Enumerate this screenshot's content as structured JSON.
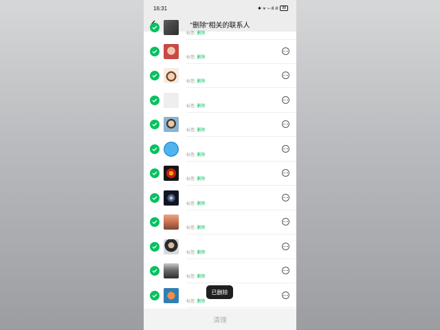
{
  "status_bar": {
    "time": "16:31",
    "icons": "✱ ᯤ ⌁ ıll ıll",
    "battery": "88"
  },
  "nav": {
    "title": "\"删除\"相关的联系人",
    "back_icon": "chevron-left-icon"
  },
  "rows": [
    {
      "tag_label": "标签:",
      "tag_value": "删除"
    },
    {
      "tag_label": "标签:",
      "tag_value": "删除"
    },
    {
      "tag_label": "标签:",
      "tag_value": "删除"
    },
    {
      "tag_label": "标签:",
      "tag_value": "删除"
    },
    {
      "tag_label": "标签:",
      "tag_value": "删除"
    },
    {
      "tag_label": "标签:",
      "tag_value": "删除"
    },
    {
      "tag_label": "标签:",
      "tag_value": "删除"
    },
    {
      "tag_label": "标签:",
      "tag_value": "删除"
    },
    {
      "tag_label": "标签:",
      "tag_value": "删除"
    },
    {
      "tag_label": "标签:",
      "tag_value": "删除"
    },
    {
      "tag_label": "标签:",
      "tag_value": "删除"
    },
    {
      "tag_label": "标签:",
      "tag_value": "删除"
    }
  ],
  "bottom": {
    "clear_label": "清理"
  },
  "toast": {
    "text": "已删除"
  },
  "colors": {
    "check_green": "#07c160",
    "tag_green": "#07c160",
    "nav_bg": "#ededed"
  }
}
